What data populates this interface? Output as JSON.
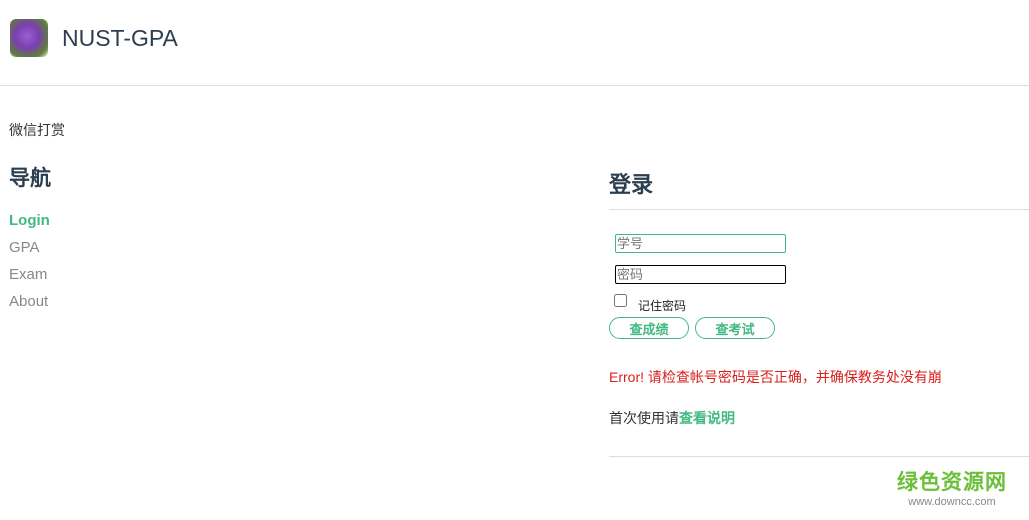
{
  "header": {
    "title": "NUST-GPA"
  },
  "donate": "微信打赏",
  "nav": {
    "heading": "导航",
    "items": [
      "Login",
      "GPA",
      "Exam",
      "About"
    ]
  },
  "login": {
    "heading": "登录",
    "student_id_placeholder": "学号",
    "password_placeholder": "密码",
    "remember": "记住密码",
    "grades_button": "查成绩",
    "exam_button": "查考试",
    "error": "Error! 请检查帐号密码是否正确，并确保教务处没有崩",
    "first_use": "首次使用请",
    "first_use_link": "查看说明"
  },
  "watermark": {
    "name": "绿色资源网",
    "url": "www.downcc.com"
  },
  "colors": {
    "accent": "#42b983",
    "error": "#d9201c"
  }
}
